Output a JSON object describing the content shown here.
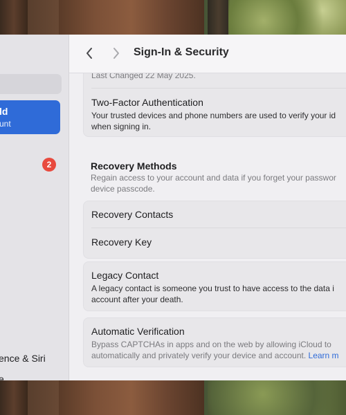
{
  "sidebar": {
    "account_name": "ld",
    "account_sub": "unt",
    "badge_count": "2",
    "item_a": "ence & Siri",
    "item_b": "e"
  },
  "toolbar": {
    "title": "Sign-In & Security"
  },
  "password_card": {
    "last_changed": "Last Changed 22 May 2025.",
    "two_factor_title": "Two-Factor Authentication",
    "two_factor_desc_line1": "Your trusted devices and phone numbers are used to verify your id",
    "two_factor_desc_line2": "when signing in."
  },
  "recovery": {
    "section_title": "Recovery Methods",
    "desc_line1": "Regain access to your account and data if you forget your passwor",
    "desc_line2": "device passcode.",
    "contacts_label": "Recovery Contacts",
    "key_label": "Recovery Key"
  },
  "legacy": {
    "title": "Legacy Contact",
    "desc_line1": "A legacy contact is someone you trust to have access to the data i",
    "desc_line2": "account after your death."
  },
  "auto_verify": {
    "title": "Automatic Verification",
    "desc_line1": "Bypass CAPTCHAs in apps and on the web by allowing iCloud to",
    "desc_line2": "automatically and privately verify your device and account.",
    "link": "Learn m"
  },
  "colors": {
    "accent": "#2f6bd8",
    "badge": "#e84a3e"
  }
}
